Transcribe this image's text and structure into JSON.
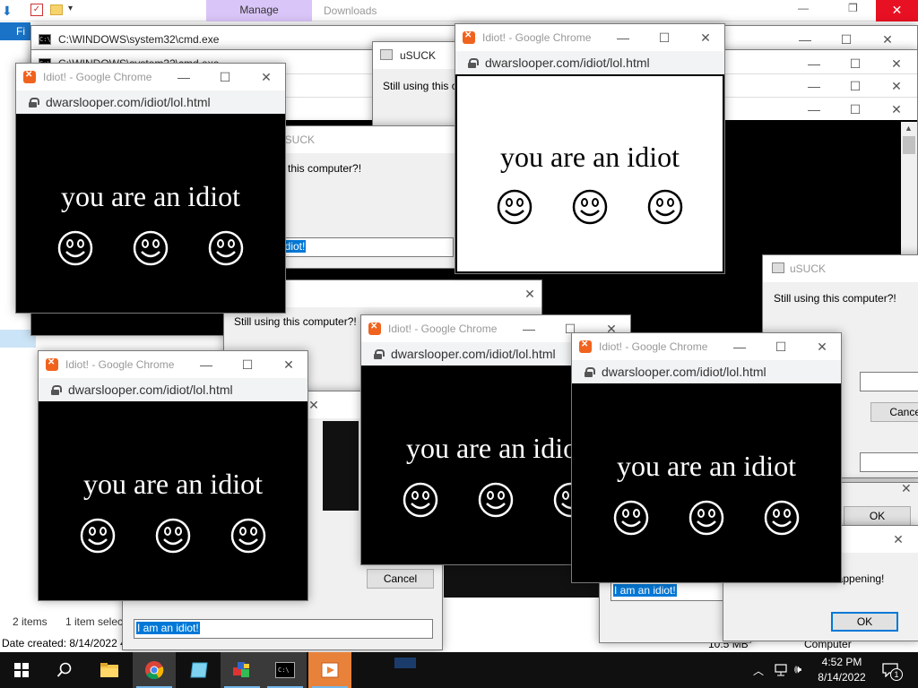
{
  "explorer": {
    "tab_manage": "Manage",
    "tab_downloads": "Downloads",
    "menu_file": "Fi",
    "status_items": "2 items",
    "status_selected": "1 item selec",
    "date_created": "Date created: 8/14/2022 4",
    "size_partial": "10.5 MB",
    "computer_partial": "Computer"
  },
  "cmd": {
    "title": "C:\\WINDOWS\\system32\\cmd.exe"
  },
  "usuck": {
    "title": "uSUCK",
    "message": "Still using this computer?!",
    "message_partial": "Still using this co",
    "message_partial2": "g this computer?!",
    "input_value": "I am an idiot!",
    "input_partial": "idiot!",
    "ok": "OK",
    "cancel": "Cancel",
    "happening": "happening!"
  },
  "chrome": {
    "title": "Idiot! - Google Chrome",
    "url": "dwarslooper.com/idiot/lol.html",
    "text": "you are an idiot",
    "colors": {
      "dark_bg": "#000000",
      "light_bg": "#ffffff"
    }
  },
  "taskbar": {
    "time": "4:52 PM",
    "date": "8/14/2022",
    "notification_count": "1"
  }
}
